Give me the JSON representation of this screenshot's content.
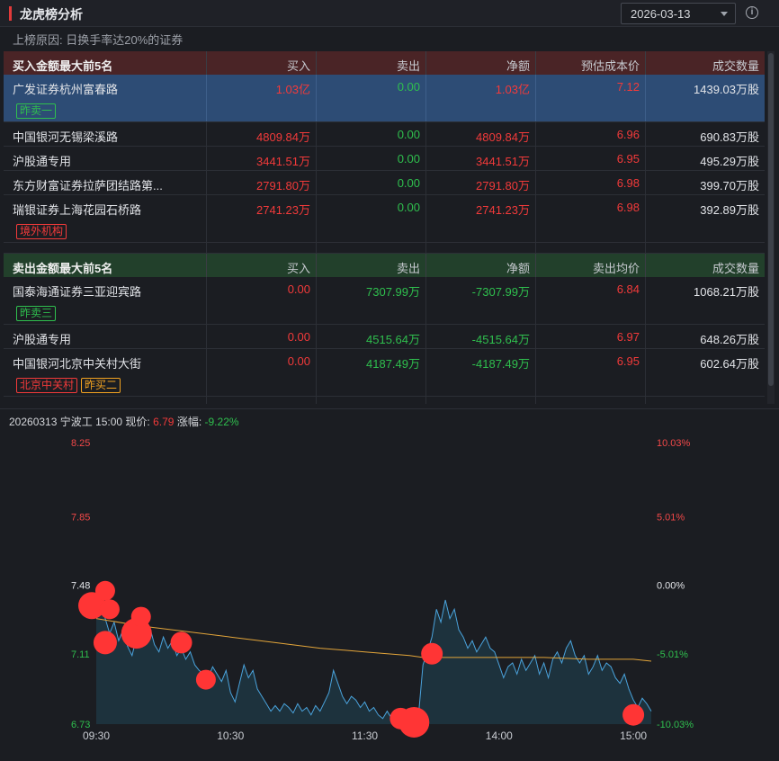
{
  "header": {
    "title": "龙虎榜分析",
    "date": "2026-03-13"
  },
  "reason": {
    "label": "上榜原因:",
    "text": "日换手率达20%的证券"
  },
  "buy_table": {
    "headers": [
      "买入金额最大前5名",
      "买入",
      "卖出",
      "净额",
      "预估成本价",
      "成交数量"
    ],
    "rows": [
      {
        "name": "广发证券杭州富春路",
        "buy": "1.03亿",
        "sell": "0.00",
        "net": "1.03亿",
        "price": "7.12",
        "volume": "1439.03万股",
        "tags": [
          {
            "text": "昨卖一",
            "color": "g"
          }
        ]
      },
      {
        "name": "中国银河无锡梁溪路",
        "buy": "4809.84万",
        "sell": "0.00",
        "net": "4809.84万",
        "price": "6.96",
        "volume": "690.83万股",
        "tags": []
      },
      {
        "name": "沪股通专用",
        "buy": "3441.51万",
        "sell": "0.00",
        "net": "3441.51万",
        "price": "6.95",
        "volume": "495.29万股",
        "tags": []
      },
      {
        "name": "东方财富证券拉萨团结路第...",
        "buy": "2791.80万",
        "sell": "0.00",
        "net": "2791.80万",
        "price": "6.98",
        "volume": "399.70万股",
        "tags": []
      },
      {
        "name": "瑞银证券上海花园石桥路",
        "buy": "2741.23万",
        "sell": "0.00",
        "net": "2741.23万",
        "price": "6.98",
        "volume": "392.89万股",
        "tags": [
          {
            "text": "境外机构",
            "color": "r"
          }
        ]
      }
    ]
  },
  "sell_table": {
    "headers": [
      "卖出金额最大前5名",
      "买入",
      "卖出",
      "净额",
      "卖出均价",
      "成交数量"
    ],
    "rows": [
      {
        "name": "国泰海通证券三亚迎宾路",
        "buy": "0.00",
        "sell": "7307.99万",
        "net": "-7307.99万",
        "price": "6.84",
        "volume": "1068.21万股",
        "tags": [
          {
            "text": "昨卖三",
            "color": "g"
          }
        ]
      },
      {
        "name": "沪股通专用",
        "buy": "0.00",
        "sell": "4515.64万",
        "net": "-4515.64万",
        "price": "6.97",
        "volume": "648.26万股",
        "tags": []
      },
      {
        "name": "中国银河北京中关村大街",
        "buy": "0.00",
        "sell": "4187.49万",
        "net": "-4187.49万",
        "price": "6.95",
        "volume": "602.64万股",
        "tags": [
          {
            "text": "北京中关村",
            "color": "r"
          },
          {
            "text": "昨买二",
            "color": "o"
          }
        ]
      }
    ]
  },
  "chart_info": {
    "prefix": "20260313 宁波",
    "suffix": "工 15:00 现价:",
    "price": "6.79",
    "change_label": "涨幅:",
    "change": "-9.22%"
  },
  "chart_data": {
    "type": "line",
    "y_left_ticks": [
      "8.25",
      "7.85",
      "7.48",
      "7.11",
      "6.73"
    ],
    "y_left_values": [
      8.25,
      7.85,
      7.48,
      7.11,
      6.73
    ],
    "y_right_ticks": [
      "10.03%",
      "5.01%",
      "0.00%",
      "-5.01%",
      "-10.03%"
    ],
    "x_ticks": [
      "09:30",
      "10:30",
      "11:30",
      "14:00",
      "15:00"
    ],
    "x_tick_minutes": [
      0,
      60,
      120,
      180,
      240
    ],
    "ylim": [
      6.73,
      8.25
    ],
    "price_points": [
      [
        0,
        7.37
      ],
      [
        2,
        7.43
      ],
      [
        4,
        7.3
      ],
      [
        6,
        7.22
      ],
      [
        8,
        7.28
      ],
      [
        10,
        7.18
      ],
      [
        12,
        7.24
      ],
      [
        14,
        7.15
      ],
      [
        16,
        7.1
      ],
      [
        18,
        7.2
      ],
      [
        20,
        7.3
      ],
      [
        22,
        7.22
      ],
      [
        24,
        7.25
      ],
      [
        26,
        7.16
      ],
      [
        28,
        7.12
      ],
      [
        30,
        7.2
      ],
      [
        32,
        7.14
      ],
      [
        34,
        7.18
      ],
      [
        36,
        7.1
      ],
      [
        38,
        7.14
      ],
      [
        40,
        7.08
      ],
      [
        42,
        7.12
      ],
      [
        44,
        7.05
      ],
      [
        46,
        7.02
      ],
      [
        48,
        7.0
      ],
      [
        50,
        6.98
      ],
      [
        52,
        7.04
      ],
      [
        54,
        7.0
      ],
      [
        56,
        6.96
      ],
      [
        58,
        7.02
      ],
      [
        60,
        6.9
      ],
      [
        62,
        6.85
      ],
      [
        64,
        6.95
      ],
      [
        66,
        7.05
      ],
      [
        68,
        6.98
      ],
      [
        70,
        7.02
      ],
      [
        72,
        6.92
      ],
      [
        74,
        6.88
      ],
      [
        76,
        6.84
      ],
      [
        78,
        6.8
      ],
      [
        80,
        6.83
      ],
      [
        82,
        6.8
      ],
      [
        84,
        6.84
      ],
      [
        86,
        6.82
      ],
      [
        88,
        6.79
      ],
      [
        90,
        6.84
      ],
      [
        92,
        6.8
      ],
      [
        94,
        6.82
      ],
      [
        96,
        6.78
      ],
      [
        98,
        6.83
      ],
      [
        100,
        6.8
      ],
      [
        102,
        6.85
      ],
      [
        104,
        6.9
      ],
      [
        106,
        7.02
      ],
      [
        108,
        6.95
      ],
      [
        110,
        6.88
      ],
      [
        112,
        6.84
      ],
      [
        114,
        6.88
      ],
      [
        116,
        6.86
      ],
      [
        118,
        6.82
      ],
      [
        120,
        6.85
      ],
      [
        122,
        6.8
      ],
      [
        124,
        6.82
      ],
      [
        126,
        6.78
      ],
      [
        128,
        6.76
      ],
      [
        130,
        6.8
      ],
      [
        132,
        6.76
      ],
      [
        134,
        6.78
      ],
      [
        136,
        6.74
      ],
      [
        138,
        6.76
      ],
      [
        140,
        6.78
      ],
      [
        142,
        6.76
      ],
      [
        144,
        6.78
      ],
      [
        146,
        7.05
      ],
      [
        148,
        7.12
      ],
      [
        150,
        7.2
      ],
      [
        152,
        7.35
      ],
      [
        154,
        7.28
      ],
      [
        156,
        7.4
      ],
      [
        158,
        7.3
      ],
      [
        160,
        7.35
      ],
      [
        162,
        7.24
      ],
      [
        164,
        7.2
      ],
      [
        166,
        7.14
      ],
      [
        168,
        7.18
      ],
      [
        170,
        7.12
      ],
      [
        172,
        7.16
      ],
      [
        174,
        7.2
      ],
      [
        176,
        7.14
      ],
      [
        178,
        7.12
      ],
      [
        180,
        7.05
      ],
      [
        182,
        6.98
      ],
      [
        184,
        7.04
      ],
      [
        186,
        7.06
      ],
      [
        188,
        7.0
      ],
      [
        190,
        7.08
      ],
      [
        192,
        7.02
      ],
      [
        194,
        7.06
      ],
      [
        196,
        7.1
      ],
      [
        198,
        7.0
      ],
      [
        200,
        7.06
      ],
      [
        202,
        6.98
      ],
      [
        204,
        7.08
      ],
      [
        206,
        7.12
      ],
      [
        208,
        7.06
      ],
      [
        210,
        7.14
      ],
      [
        212,
        7.18
      ],
      [
        214,
        7.1
      ],
      [
        216,
        7.06
      ],
      [
        218,
        7.1
      ],
      [
        220,
        7.0
      ],
      [
        222,
        7.04
      ],
      [
        224,
        7.1
      ],
      [
        226,
        7.02
      ],
      [
        228,
        7.06
      ],
      [
        230,
        7.04
      ],
      [
        232,
        6.98
      ],
      [
        234,
        6.95
      ],
      [
        236,
        7.0
      ],
      [
        238,
        6.92
      ],
      [
        240,
        6.86
      ],
      [
        242,
        6.82
      ],
      [
        244,
        6.87
      ],
      [
        246,
        6.84
      ],
      [
        248,
        6.8
      ]
    ],
    "avg_points": [
      [
        0,
        7.3
      ],
      [
        20,
        7.26
      ],
      [
        40,
        7.23
      ],
      [
        60,
        7.2
      ],
      [
        80,
        7.17
      ],
      [
        100,
        7.14
      ],
      [
        120,
        7.12
      ],
      [
        140,
        7.1
      ],
      [
        146,
        7.09
      ],
      [
        160,
        7.09
      ],
      [
        180,
        7.09
      ],
      [
        200,
        7.09
      ],
      [
        220,
        7.08
      ],
      [
        240,
        7.08
      ],
      [
        248,
        7.07
      ]
    ],
    "bubbles": [
      [
        -2,
        7.37,
        15
      ],
      [
        4,
        7.45,
        11
      ],
      [
        6,
        7.35,
        11
      ],
      [
        4,
        7.17,
        13
      ],
      [
        18,
        7.22,
        17
      ],
      [
        20,
        7.31,
        11
      ],
      [
        38,
        7.17,
        12
      ],
      [
        49,
        6.97,
        11
      ],
      [
        136,
        6.76,
        12
      ],
      [
        142,
        6.74,
        17
      ],
      [
        150,
        7.11,
        12
      ],
      [
        240,
        6.78,
        12
      ]
    ]
  }
}
